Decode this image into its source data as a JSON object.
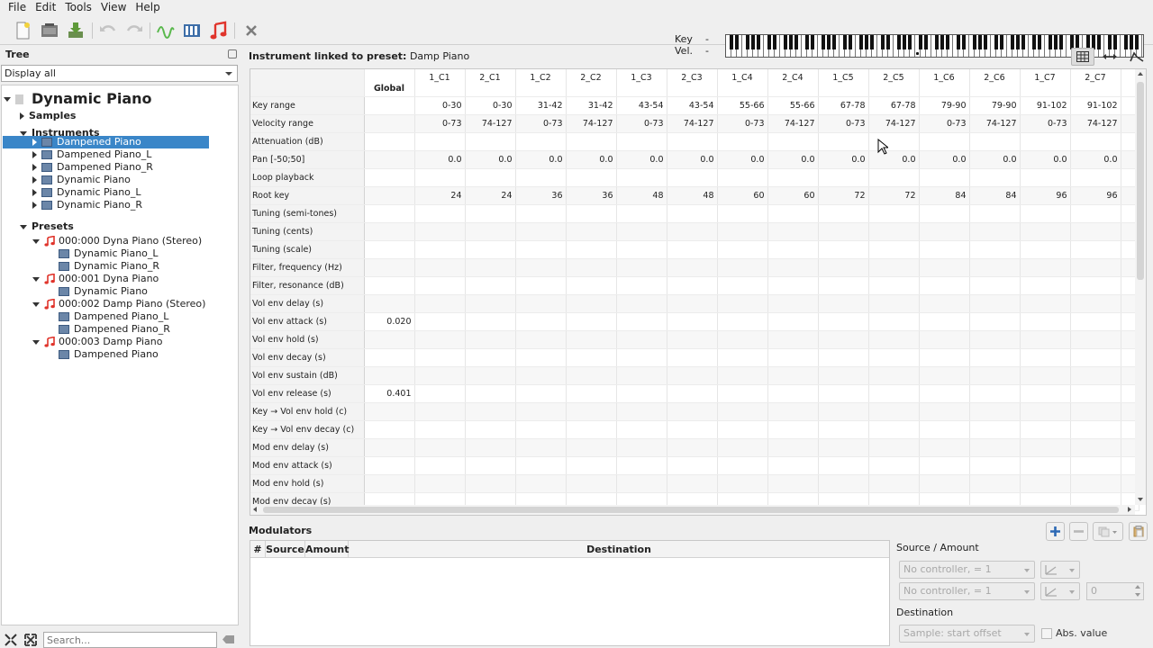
{
  "menu": [
    "File",
    "Edit",
    "Tools",
    "View",
    "Help"
  ],
  "keyboard": {
    "key_label": "Key",
    "key_value": "-",
    "vel_label": "Vel.",
    "vel_value": "-"
  },
  "tree": {
    "title": "Tree",
    "filter": "Display all",
    "search_placeholder": "Search...",
    "root": "Dynamic Piano",
    "samples_label": "Samples",
    "instruments_label": "Instruments",
    "instruments": [
      "Dampened Piano",
      "Dampened Piano_L",
      "Dampened Piano_R",
      "Dynamic Piano",
      "Dynamic Piano_L",
      "Dynamic Piano_R"
    ],
    "presets_label": "Presets",
    "presets": [
      {
        "label": "000:000 Dyna Piano (Stereo)",
        "children": [
          "Dynamic Piano_L",
          "Dynamic Piano_R"
        ]
      },
      {
        "label": "000:001 Dyna Piano",
        "children": [
          "Dynamic Piano"
        ]
      },
      {
        "label": "000:002 Damp Piano (Stereo)",
        "children": [
          "Dampened Piano_L",
          "Dampened Piano_R"
        ]
      },
      {
        "label": "000:003 Damp Piano",
        "children": [
          "Dampened Piano"
        ]
      }
    ]
  },
  "editor": {
    "header_label": "Instrument linked to preset:",
    "header_value": "Damp Piano",
    "global_label": "Global",
    "columns": [
      "1_C1",
      "2_C1",
      "1_C2",
      "2_C2",
      "1_C3",
      "2_C3",
      "1_C4",
      "2_C4",
      "1_C5",
      "2_C5",
      "1_C6",
      "2_C6",
      "1_C7",
      "2_C7"
    ],
    "rows": [
      {
        "label": "Key range",
        "global": "",
        "values": [
          "0-30",
          "0-30",
          "31-42",
          "31-42",
          "43-54",
          "43-54",
          "55-66",
          "55-66",
          "67-78",
          "67-78",
          "79-90",
          "79-90",
          "91-102",
          "91-102"
        ]
      },
      {
        "label": "Velocity range",
        "global": "",
        "values": [
          "0-73",
          "74-127",
          "0-73",
          "74-127",
          "0-73",
          "74-127",
          "0-73",
          "74-127",
          "0-73",
          "74-127",
          "0-73",
          "74-127",
          "0-73",
          "74-127"
        ]
      },
      {
        "label": "Attenuation (dB)",
        "global": "",
        "values": []
      },
      {
        "label": "Pan [-50;50]",
        "global": "",
        "values": [
          "0.0",
          "0.0",
          "0.0",
          "0.0",
          "0.0",
          "0.0",
          "0.0",
          "0.0",
          "0.0",
          "0.0",
          "0.0",
          "0.0",
          "0.0",
          "0.0"
        ]
      },
      {
        "label": "Loop playback",
        "global": "",
        "values": []
      },
      {
        "label": "Root key",
        "global": "",
        "values": [
          "24",
          "24",
          "36",
          "36",
          "48",
          "48",
          "60",
          "60",
          "72",
          "72",
          "84",
          "84",
          "96",
          "96"
        ]
      },
      {
        "label": "Tuning (semi-tones)",
        "global": "",
        "values": []
      },
      {
        "label": "Tuning (cents)",
        "global": "",
        "values": []
      },
      {
        "label": "Tuning (scale)",
        "global": "",
        "values": []
      },
      {
        "label": "Filter, frequency (Hz)",
        "global": "",
        "values": []
      },
      {
        "label": "Filter, resonance (dB)",
        "global": "",
        "values": []
      },
      {
        "label": "Vol env delay (s)",
        "global": "",
        "values": []
      },
      {
        "label": "Vol env attack (s)",
        "global": "0.020",
        "values": []
      },
      {
        "label": "Vol env hold (s)",
        "global": "",
        "values": []
      },
      {
        "label": "Vol env decay (s)",
        "global": "",
        "values": []
      },
      {
        "label": "Vol env sustain (dB)",
        "global": "",
        "values": []
      },
      {
        "label": "Vol env release (s)",
        "global": "0.401",
        "values": []
      },
      {
        "label": "Key → Vol env hold (c)",
        "global": "",
        "values": []
      },
      {
        "label": "Key → Vol env decay (c)",
        "global": "",
        "values": []
      },
      {
        "label": "Mod env delay (s)",
        "global": "",
        "values": []
      },
      {
        "label": "Mod env attack (s)",
        "global": "",
        "values": []
      },
      {
        "label": "Mod env hold (s)",
        "global": "",
        "values": []
      },
      {
        "label": "Mod env decay (s)",
        "global": "",
        "values": []
      }
    ]
  },
  "modulators": {
    "title": "Modulators",
    "columns": [
      "#",
      "Source",
      "Amount",
      "Destination"
    ],
    "source_amount_label": "Source / Amount",
    "source_1": "No controller, = 1",
    "source_2": "No controller, = 1",
    "amount_value": "0",
    "destination_label": "Destination",
    "destination_value": "Sample: start offset",
    "abs_value_label": "Abs. value"
  }
}
